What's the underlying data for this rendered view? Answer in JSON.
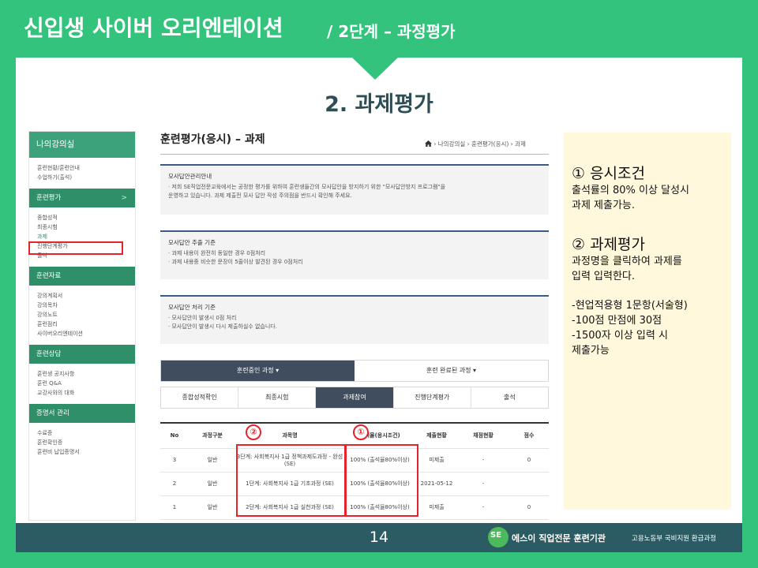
{
  "header": {
    "title": "신입생 사이버 오리엔테이션",
    "subtitle": "/ 2단계 – 과정평가"
  },
  "slide_title": "2. 과제평가",
  "sidebar": {
    "head": "나의강의실",
    "group1": [
      "훈련현황/훈련안내",
      "수업하기(출석)"
    ],
    "sections": [
      {
        "label": "훈련평가",
        "chevron": ">",
        "items": [
          "종합성적",
          "최종시험",
          "과제",
          "진행단계평가",
          "출석"
        ]
      },
      {
        "label": "훈련자료",
        "items": [
          "강의계획서",
          "강의목차",
          "강의노트",
          "훈련점리",
          "사이버오리엔테이션"
        ]
      },
      {
        "label": "훈련상담",
        "items": [
          "훈련생 공지사항",
          "훈련 Q&A",
          "교강사와의 대화"
        ]
      },
      {
        "label": "증명서 관리",
        "items": [
          "수료증",
          "훈련확인증",
          "훈련비 납입증명서"
        ]
      }
    ]
  },
  "main": {
    "title": "훈련평가(응시) – 과제",
    "breadcrumb": "› 나의강의실 › 훈련평가(응시) › 과제",
    "notices": [
      {
        "title": "모사답안관리안내",
        "lines": [
          "· 저희 SE직업전문교육에서는 공정한 평가를 위하여 훈련생들간의 모사답안을 방지하기 위한 \"모사답안방지 프로그램\"을",
          "  운영하고 있습니다. 과제 제출전 모사 답안 작성 주의점을 반드시 확인해 주세요."
        ]
      },
      {
        "title": "모사답안 추출 기준",
        "lines": [
          "· 과제 내용이 완전히 동일한 경우 0점처리",
          "· 과제 내용중 비슷한 문장이 5줄이상 발견된 경우 0점처리"
        ]
      },
      {
        "title": "모사답안 처리 기준",
        "lines": [
          "· 모사답안이 발생시 0점 처리",
          "· 모사답안이 발생시 다시 제출하실수 없습니다."
        ]
      }
    ],
    "tabs1": [
      "훈련중인 과정 ▾",
      "훈련 완료된 과정 ▾"
    ],
    "tabs2": [
      "종합성적확인",
      "최종시험",
      "과제참여",
      "진행단계평가",
      "출석"
    ],
    "table": {
      "headers": [
        "No",
        "과정구분",
        "과목명",
        "출석율(응시조건)",
        "제출현황",
        "채점현황",
        "점수"
      ],
      "rows": [
        [
          "3",
          "일반",
          "3단계: 사회복지사 1급 정책과제도과정 - 완성 (SE)",
          "100% (출석율80%이상)",
          "미제출",
          "-",
          "0"
        ],
        [
          "2",
          "일반",
          "1단계: 사회복지사 1급 기초과정 (SE)",
          "100% (출석율80%이상)",
          "2021-05-12",
          "-",
          ""
        ],
        [
          "1",
          "일반",
          "2단계: 사회복지사 1급 실천과정 (SE)",
          "100% (출석율80%이상)",
          "미제출",
          "-",
          "0"
        ]
      ]
    },
    "markers": [
      "②",
      "①"
    ]
  },
  "panel": {
    "h1": "① 응시조건",
    "t1": [
      "출석률의 80% 이상 달성시",
      "과제 제출가능."
    ],
    "h2": "② 과제평가",
    "t2": [
      "과정명을 클릭하여 과제를",
      "입력 입력한다."
    ],
    "t3": [
      "-현업적용형 1문항(서술형)",
      "-100점 만점에 30점",
      "-1500자 이상 입력 시",
      " 제출가능"
    ]
  },
  "footer": {
    "page": "14",
    "logo": "SE",
    "org": "에스이 직업전문 훈련기관",
    "org_sub": "고용노동부 국비지원 환급과정"
  },
  "colors": {
    "brand_green": "#33c37c",
    "footer_teal": "#2b5c63",
    "highlight_red": "#e3242b",
    "panel_bg": "#fff8dc"
  }
}
